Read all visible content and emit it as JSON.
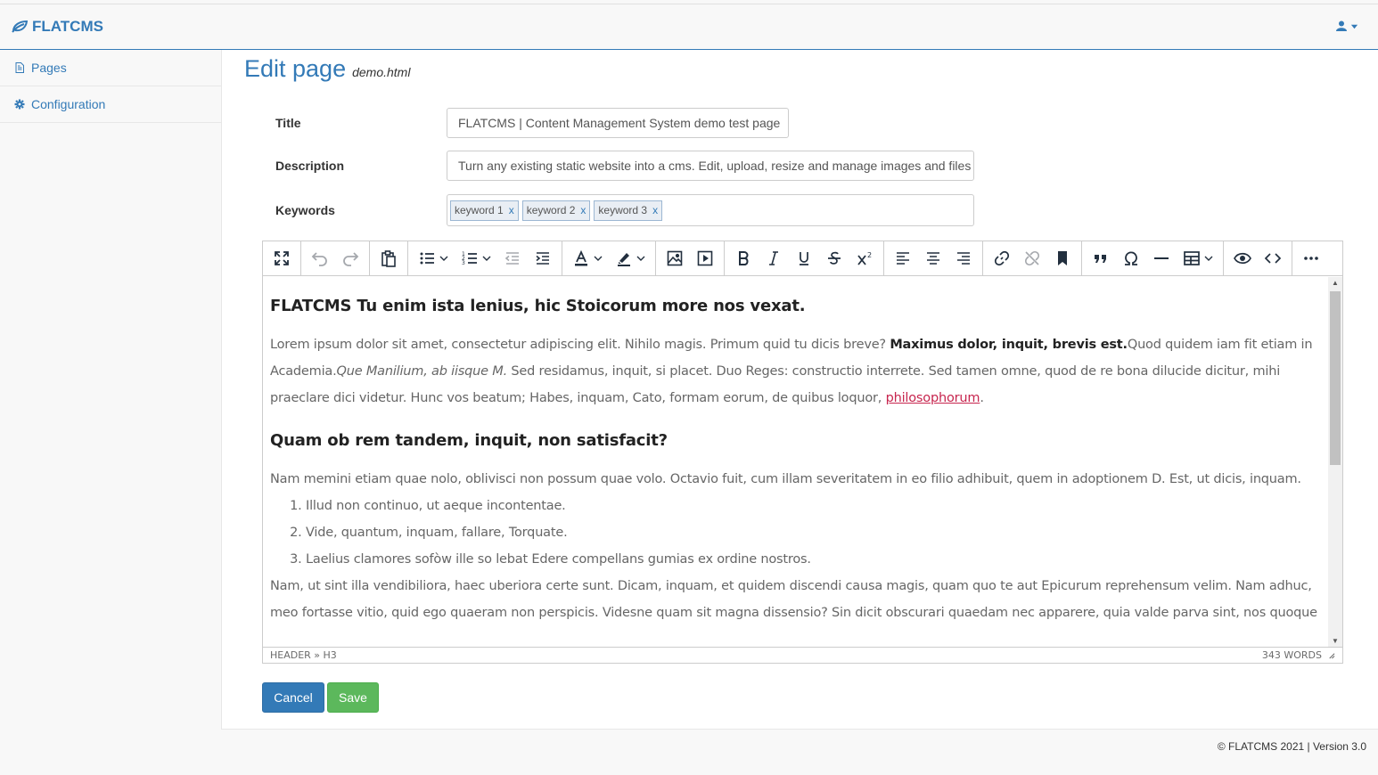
{
  "brand": {
    "name": "FLATCMS",
    "icon": "leaf-icon"
  },
  "user_menu": {
    "icon": "user-icon"
  },
  "sidebar": {
    "items": [
      {
        "label": "Pages",
        "icon": "file-icon"
      },
      {
        "label": "Configuration",
        "icon": "gear-icon"
      }
    ]
  },
  "page": {
    "title": "Edit page",
    "filename": "demo.html"
  },
  "form": {
    "title_label": "Title",
    "title_value": "FLATCMS | Content Management System demo test page",
    "description_label": "Description",
    "description_value": "Turn any existing static website into a cms. Edit, upload, resize and manage images and files",
    "keywords_label": "Keywords",
    "keywords": [
      "keyword 1",
      "keyword 2",
      "keyword 3"
    ],
    "tag_remove": "x"
  },
  "editor": {
    "heading1": "FLATCMS Tu enim ista lenius, hic Stoicorum more nos vexat.",
    "p1_a": "Lorem ipsum dolor sit amet, consectetur adipiscing elit. Nihilo magis. Primum quid tu dicis breve? ",
    "p1_b": "Maximus dolor, inquit, brevis est.",
    "p1_c": "Quod quidem iam fit etiam in Academia.",
    "p1_d": "Que Manilium, ab iisque M.",
    "p1_e": " Sed residamus, inquit, si placet. Duo Reges: constructio interrete. Sed tamen omne, quod de re bona dilucide dicitur, mihi praeclare dici videtur. Hunc vos beatum; Habes, inquam, Cato, formam eorum, de quibus loquor, ",
    "p1_link": "philosophorum",
    "p1_end": ".",
    "heading2": "Quam ob rem tandem, inquit, non satisfacit?",
    "p2": "Nam memini etiam quae nolo, oblivisci non possum quae volo. Octavio fuit, cum illam severitatem in eo filio adhibuit, quem in adoptionem D. Est, ut dicis, inquam.",
    "list": [
      "Illud non continuo, ut aeque incontentae.",
      "Vide, quantum, inquam, fallare, Torquate.",
      "Laelius clamores sofòw ille so lebat Edere compellans gumias ex ordine nostros."
    ],
    "p3": "Nam, ut sint illa vendibiliora, haec uberiora certe sunt. Dicam, inquam, et quidem discendi causa magis, quam quo te aut Epicurum reprehensum velim. Nam adhuc, meo fortasse vitio, quid ego quaeram non perspicis. Videsne quam sit magna dissensio? Sin dicit obscurari quaedam nec apparere, quia valde parva sint, nos quoque",
    "path": "HEADER » H3",
    "word_count": "343 WORDS"
  },
  "buttons": {
    "cancel": "Cancel",
    "save": "Save"
  },
  "footer": "© FLATCMS 2021 | Version 3.0",
  "colors": {
    "primary": "#337ab7",
    "success": "#5cb85c",
    "link": "#c7254e"
  }
}
